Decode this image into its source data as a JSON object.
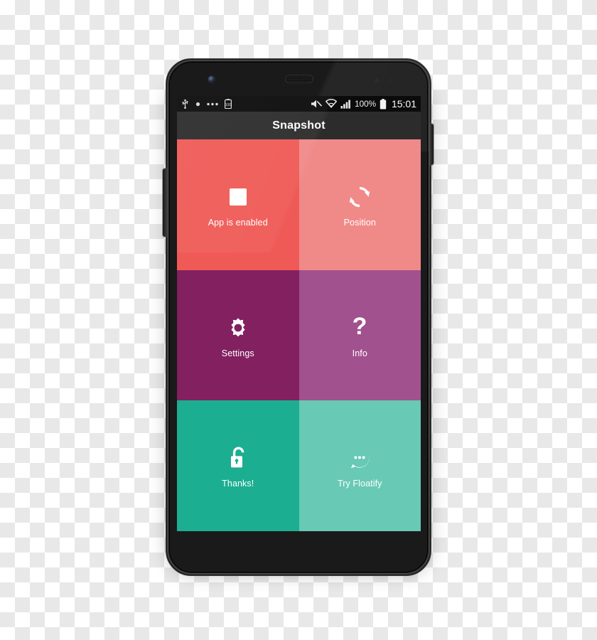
{
  "app": {
    "title": "Snapshot"
  },
  "status_bar": {
    "left_icons": [
      "usb-icon",
      "dot-icon",
      "more-dots-icon",
      "battery-saver-icon"
    ],
    "right_icons": [
      "mute-icon",
      "wifi-icon",
      "signal-icon"
    ],
    "battery_percent": "100%",
    "battery_icon": "battery-full-icon",
    "clock": "15:01"
  },
  "tiles": [
    {
      "label": "App is enabled",
      "icon": "stop-square-icon",
      "color": "#EF5A56"
    },
    {
      "label": "Position",
      "icon": "sync-rotate-icon",
      "color": "#F08A89"
    },
    {
      "label": "Settings",
      "icon": "gear-icon",
      "color": "#82206090"
    },
    {
      "label": "Info",
      "icon": "question-mark-icon",
      "color": "#A1518D"
    },
    {
      "label": "Thanks!",
      "icon": "unlock-icon",
      "color": "#1CAE91"
    },
    {
      "label": "Try Floatify",
      "icon": "chat-bubble-dots-icon",
      "color": "#68C9B5"
    }
  ],
  "colors": {
    "tile_1": "#EF5A56",
    "tile_2": "#F08A89",
    "tile_3": "#822060",
    "tile_4": "#A1518D",
    "tile_5": "#1CAE91",
    "tile_6": "#68C9B5",
    "action_bar": "#2C2C2C",
    "status_bar": "#0B0B0B",
    "device_body": "#1A1A1A"
  }
}
